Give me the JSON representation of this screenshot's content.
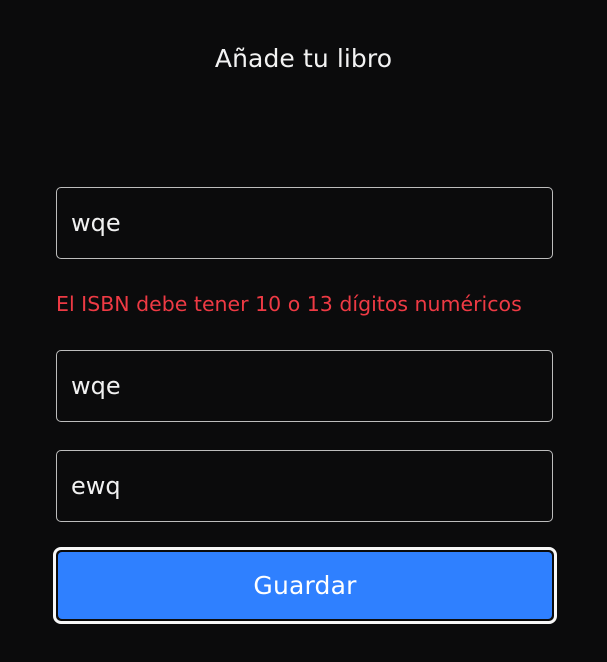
{
  "form": {
    "title": "Añade tu libro",
    "isbn": {
      "value": "wqe",
      "error": "El ISBN debe tener 10 o 13 dígitos numéricos"
    },
    "field_two": {
      "value": "wqe"
    },
    "field_three": {
      "value": "ewq"
    },
    "save_label": "Guardar"
  },
  "colors": {
    "background": "#0b0b0c",
    "error": "#ee3a44",
    "button": "#2f80ff",
    "field_border": "#bdbdbd"
  }
}
